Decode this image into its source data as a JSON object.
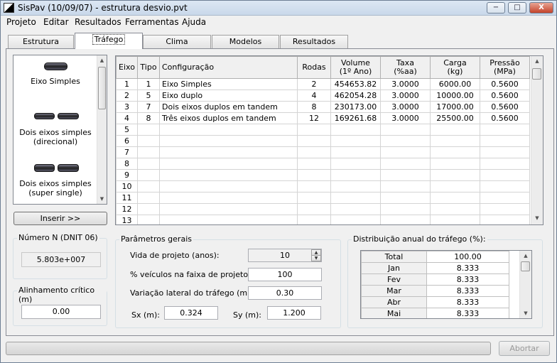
{
  "window": {
    "title": "SisPav (10/09/07) - estrutura desvio.pvt",
    "min": "−",
    "max": "□",
    "close": "X"
  },
  "menu": [
    "Projeto",
    "Editar",
    "Resultados",
    "Ferramentas",
    "Ajuda"
  ],
  "tabs": [
    "Estrutura",
    "Tráfego",
    "Clima",
    "Modelos",
    "Resultados"
  ],
  "axle_types": [
    "Eixo Simples",
    "Dois eixos simples\n(direcional)",
    "Dois eixos simples\n(super single)"
  ],
  "insert_button": "Inserir >>",
  "grid": {
    "headers": [
      "Eixo",
      "Tipo",
      "Configuração",
      "Rodas",
      "Volume\n(1º Ano)",
      "Taxa\n(%aa)",
      "Carga\n(kg)",
      "Pressão\n(MPa)"
    ],
    "rows": [
      [
        "1",
        "1",
        "Eixo Simples",
        "2",
        "454653.82",
        "3.0000",
        "6000.00",
        "0.5600"
      ],
      [
        "2",
        "5",
        "Eixo duplo",
        "4",
        "462054.28",
        "3.0000",
        "10000.00",
        "0.5600"
      ],
      [
        "3",
        "7",
        "Dois eixos duplos em tandem",
        "8",
        "230173.00",
        "3.0000",
        "17000.00",
        "0.5600"
      ],
      [
        "4",
        "8",
        "Três eixos duplos em tandem",
        "12",
        "169261.68",
        "3.0000",
        "25500.00",
        "0.5600"
      ],
      [
        "5",
        "",
        "",
        "",
        "",
        "",
        "",
        ""
      ],
      [
        "6",
        "",
        "",
        "",
        "",
        "",
        "",
        ""
      ],
      [
        "7",
        "",
        "",
        "",
        "",
        "",
        "",
        ""
      ],
      [
        "8",
        "",
        "",
        "",
        "",
        "",
        "",
        ""
      ],
      [
        "9",
        "",
        "",
        "",
        "",
        "",
        "",
        ""
      ],
      [
        "10",
        "",
        "",
        "",
        "",
        "",
        "",
        ""
      ],
      [
        "11",
        "",
        "",
        "",
        "",
        "",
        "",
        ""
      ],
      [
        "12",
        "",
        "",
        "",
        "",
        "",
        "",
        ""
      ],
      [
        "13",
        "",
        "",
        "",
        "",
        "",
        "",
        ""
      ]
    ]
  },
  "n_dnit": {
    "label": "Número N (DNIT 06)",
    "value": "5.803e+007"
  },
  "alinhamento": {
    "label": "Alinhamento crítico (m)",
    "value": "0.00"
  },
  "params": {
    "title": "Parâmetros gerais",
    "vida_label": "Vida de projeto (anos):",
    "vida_value": "10",
    "veiculos_label": "% veículos na faixa de projeto:",
    "veiculos_value": "100",
    "variacao_label": "Variação lateral do tráfego (m):",
    "variacao_value": "0.30",
    "sx_label": "Sx (m):",
    "sx_value": "0.324",
    "sy_label": "Sy (m):",
    "sy_value": "1.200"
  },
  "distribution": {
    "title": "Distribuição anual do tráfego (%):",
    "rows": [
      [
        "Total",
        "100.00"
      ],
      [
        "Jan",
        "8.333"
      ],
      [
        "Fev",
        "8.333"
      ],
      [
        "Mar",
        "8.333"
      ],
      [
        "Abr",
        "8.333"
      ],
      [
        "Mai",
        "8.333"
      ]
    ]
  },
  "abort_button": "Abortar"
}
